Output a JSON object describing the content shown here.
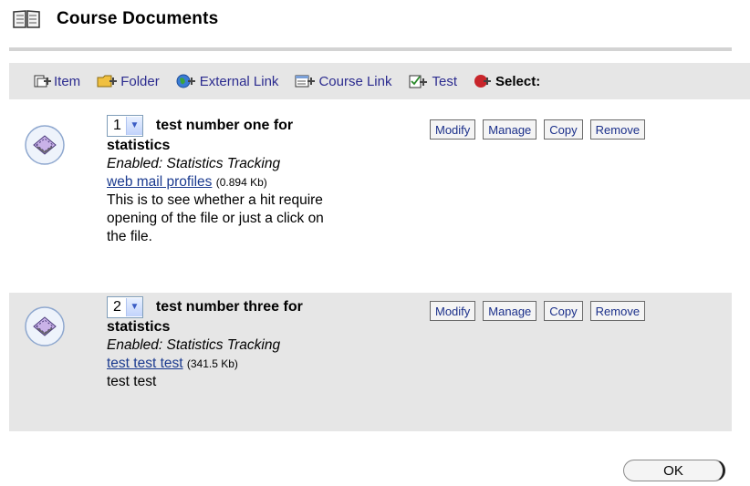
{
  "page": {
    "title": "Course Documents"
  },
  "toolbar": {
    "items": [
      {
        "label": "Item",
        "icon": "item-add-icon"
      },
      {
        "label": "Folder",
        "icon": "folder-add-icon"
      },
      {
        "label": "External Link",
        "icon": "globe-add-icon"
      },
      {
        "label": "Course Link",
        "icon": "course-link-add-icon"
      },
      {
        "label": "Test",
        "icon": "test-add-icon"
      },
      {
        "label": "Select:",
        "icon": "select-add-icon"
      }
    ]
  },
  "items": [
    {
      "order": "1",
      "title": "test number one for",
      "title_cont": "statistics",
      "enabled": "Enabled: Statistics Tracking",
      "link": "web mail profiles",
      "size": "(0.894 Kb)",
      "desc": [
        "This is to see whether a hit require",
        "opening of the file or just a click on",
        "the file."
      ],
      "actions": [
        "Modify",
        "Manage",
        "Copy",
        "Remove"
      ]
    },
    {
      "order": "2",
      "title": "test number three for",
      "title_cont": "statistics",
      "enabled": "Enabled: Statistics Tracking",
      "link": "test test test",
      "size": "(341.5 Kb)",
      "desc": [
        "test test"
      ],
      "actions": [
        "Modify",
        "Manage",
        "Copy",
        "Remove"
      ]
    }
  ],
  "footer": {
    "ok_label": "OK"
  },
  "colors": {
    "toolbar_bg": "#e6e6e6",
    "link": "#1a3a8f",
    "row_alt_bg": "#e6e6e6"
  }
}
